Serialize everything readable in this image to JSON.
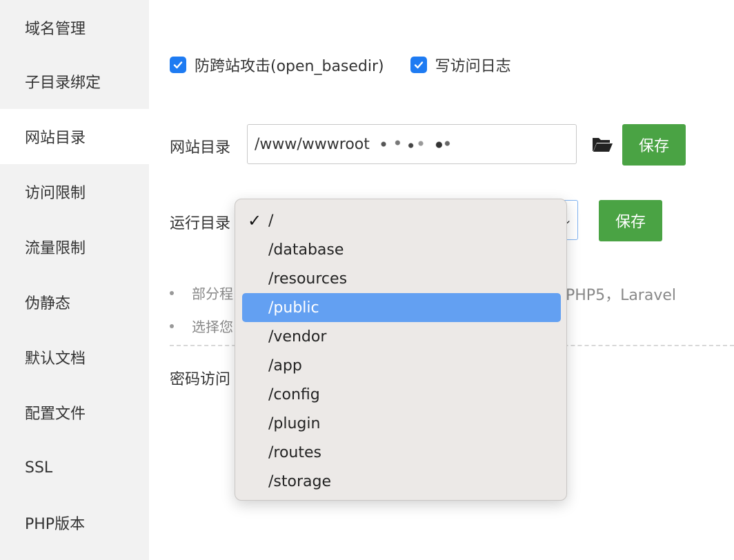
{
  "sidebar": {
    "items": [
      {
        "label": "域名管理"
      },
      {
        "label": "子目录绑定"
      },
      {
        "label": "网站目录"
      },
      {
        "label": "访问限制"
      },
      {
        "label": "流量限制"
      },
      {
        "label": "伪静态"
      },
      {
        "label": "默认文档"
      },
      {
        "label": "配置文件"
      },
      {
        "label": "SSL"
      },
      {
        "label": "PHP版本"
      }
    ],
    "active_index": 2
  },
  "checkboxes": {
    "anti_xss": {
      "label": "防跨站攻击(open_basedir)",
      "checked": true
    },
    "access_log": {
      "label": "写访问日志",
      "checked": true
    }
  },
  "site_dir": {
    "label": "网站目录",
    "value": "/www/wwwroot",
    "save_label": "保存"
  },
  "run_dir": {
    "label": "运行目录",
    "save_label": "保存",
    "options": [
      "/",
      "/database",
      "/resources",
      "/public",
      "/vendor",
      "/app",
      "/config",
      "/plugin",
      "/routes",
      "/storage"
    ],
    "selected": "/",
    "hovered": "/public"
  },
  "tips": {
    "tip1_start": "部分程",
    "tip1_end": "PHP5，Laravel",
    "tip2_start": "选择您"
  },
  "password_label": "密码访问",
  "colors": {
    "accent": "#1e7bf2",
    "save_button": "#4aa344",
    "sidebar_bg": "#f2f2f2",
    "highlight": "#63a0f2"
  }
}
